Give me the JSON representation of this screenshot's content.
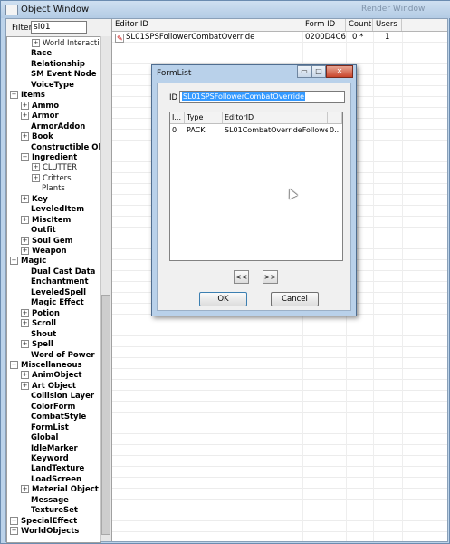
{
  "window": {
    "title": "Object Window",
    "background_title": "Render Window"
  },
  "filter": {
    "label": "Filter",
    "value": "sl01"
  },
  "tree": [
    {
      "label": "World Interactio",
      "indent": 2,
      "expander": "+",
      "bold": false
    },
    {
      "label": "Race",
      "indent": 1,
      "expander": "",
      "bold": true
    },
    {
      "label": "Relationship",
      "indent": 1,
      "expander": "",
      "bold": true
    },
    {
      "label": "SM Event Node",
      "indent": 1,
      "expander": "",
      "bold": true
    },
    {
      "label": "VoiceType",
      "indent": 1,
      "expander": "",
      "bold": true
    },
    {
      "label": "Items",
      "indent": 0,
      "expander": "−",
      "bold": true
    },
    {
      "label": "Ammo",
      "indent": 1,
      "expander": "+",
      "bold": true
    },
    {
      "label": "Armor",
      "indent": 1,
      "expander": "+",
      "bold": true
    },
    {
      "label": "ArmorAddon",
      "indent": 1,
      "expander": "",
      "bold": true
    },
    {
      "label": "Book",
      "indent": 1,
      "expander": "+",
      "bold": true
    },
    {
      "label": "Constructible Ob",
      "indent": 1,
      "expander": "",
      "bold": true
    },
    {
      "label": "Ingredient",
      "indent": 1,
      "expander": "−",
      "bold": true
    },
    {
      "label": "CLUTTER",
      "indent": 2,
      "expander": "+",
      "bold": false
    },
    {
      "label": "Critters",
      "indent": 2,
      "expander": "+",
      "bold": false
    },
    {
      "label": "Plants",
      "indent": 2,
      "expander": "",
      "bold": false
    },
    {
      "label": "Key",
      "indent": 1,
      "expander": "+",
      "bold": true
    },
    {
      "label": "LeveledItem",
      "indent": 1,
      "expander": "",
      "bold": true
    },
    {
      "label": "MiscItem",
      "indent": 1,
      "expander": "+",
      "bold": true
    },
    {
      "label": "Outfit",
      "indent": 1,
      "expander": "",
      "bold": true
    },
    {
      "label": "Soul Gem",
      "indent": 1,
      "expander": "+",
      "bold": true
    },
    {
      "label": "Weapon",
      "indent": 1,
      "expander": "+",
      "bold": true
    },
    {
      "label": "Magic",
      "indent": 0,
      "expander": "−",
      "bold": true
    },
    {
      "label": "Dual Cast Data",
      "indent": 1,
      "expander": "",
      "bold": true
    },
    {
      "label": "Enchantment",
      "indent": 1,
      "expander": "",
      "bold": true
    },
    {
      "label": "LeveledSpell",
      "indent": 1,
      "expander": "",
      "bold": true
    },
    {
      "label": "Magic Effect",
      "indent": 1,
      "expander": "",
      "bold": true
    },
    {
      "label": "Potion",
      "indent": 1,
      "expander": "+",
      "bold": true
    },
    {
      "label": "Scroll",
      "indent": 1,
      "expander": "+",
      "bold": true
    },
    {
      "label": "Shout",
      "indent": 1,
      "expander": "",
      "bold": true
    },
    {
      "label": "Spell",
      "indent": 1,
      "expander": "+",
      "bold": true
    },
    {
      "label": "Word of Power",
      "indent": 1,
      "expander": "",
      "bold": true
    },
    {
      "label": "Miscellaneous",
      "indent": 0,
      "expander": "−",
      "bold": true
    },
    {
      "label": "AnimObject",
      "indent": 1,
      "expander": "+",
      "bold": true
    },
    {
      "label": "Art Object",
      "indent": 1,
      "expander": "+",
      "bold": true
    },
    {
      "label": "Collision Layer",
      "indent": 1,
      "expander": "",
      "bold": true
    },
    {
      "label": "ColorForm",
      "indent": 1,
      "expander": "",
      "bold": true
    },
    {
      "label": "CombatStyle",
      "indent": 1,
      "expander": "",
      "bold": true
    },
    {
      "label": "FormList",
      "indent": 1,
      "expander": "",
      "bold": true
    },
    {
      "label": "Global",
      "indent": 1,
      "expander": "",
      "bold": true
    },
    {
      "label": "IdleMarker",
      "indent": 1,
      "expander": "",
      "bold": true
    },
    {
      "label": "Keyword",
      "indent": 1,
      "expander": "",
      "bold": true
    },
    {
      "label": "LandTexture",
      "indent": 1,
      "expander": "",
      "bold": true
    },
    {
      "label": "LoadScreen",
      "indent": 1,
      "expander": "",
      "bold": true
    },
    {
      "label": "Material Object",
      "indent": 1,
      "expander": "+",
      "bold": true
    },
    {
      "label": "Message",
      "indent": 1,
      "expander": "",
      "bold": true
    },
    {
      "label": "TextureSet",
      "indent": 1,
      "expander": "",
      "bold": true
    },
    {
      "label": "SpecialEffect",
      "indent": 0,
      "expander": "+",
      "bold": true
    },
    {
      "label": "WorldObjects",
      "indent": 0,
      "expander": "+",
      "bold": true
    }
  ],
  "list": {
    "columns": [
      "Editor ID",
      "Form ID",
      "Count",
      "Users"
    ],
    "rows": [
      {
        "editor_id": "SL01SPSFollowerCombatOverride",
        "form_id": "0200D4C6",
        "count": "0 *",
        "users": "1"
      }
    ]
  },
  "dialog": {
    "title": "FormList",
    "min_glyph": "▭",
    "max_glyph": "□",
    "close_glyph": "✕",
    "id_label": "ID",
    "id_value": "SL01SPSFollowerCombatOverride",
    "table_columns": [
      "I...",
      "Type",
      "EditorID",
      ""
    ],
    "table_rows": [
      {
        "index": "0",
        "type": "PACK",
        "editor_id": "SL01CombatOverrideFollowe...",
        "extra": "0..."
      }
    ],
    "prev_label": "<<",
    "next_label": ">>",
    "ok_label": "OK",
    "cancel_label": "Cancel"
  }
}
